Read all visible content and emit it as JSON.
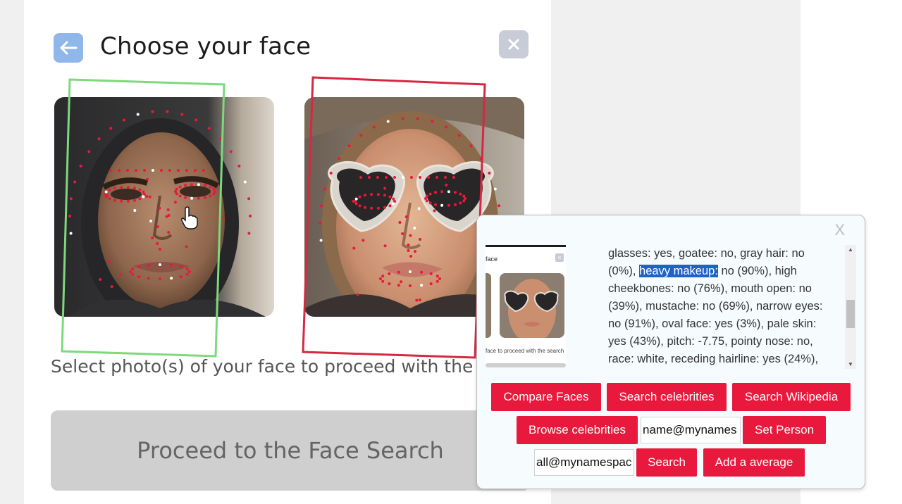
{
  "modal": {
    "title": "Choose your face",
    "instructions": "Select photo(s) of your face to proceed with the s",
    "proceed_label": "Proceed to the Face Search"
  },
  "icons": {
    "back": "arrow-left-icon",
    "close": "close-icon",
    "cursor": "hand-pointer-icon"
  },
  "colors": {
    "back_button": "#8fb7ea",
    "close_button": "#c7ccd6",
    "selected_frame": "#7ed87e",
    "unselected_frame": "#d62840",
    "landmark_red": "#e8193c",
    "action_button": "#e8193c",
    "highlight": "#1e64c8"
  },
  "popup": {
    "close_label": "X",
    "thumbnail": {
      "title": "face",
      "caption": "face to proceed with the search"
    },
    "info": {
      "before": "glasses: yes, goatee: no, gray hair: no (0%), ",
      "highlight": "heavy makeup:",
      "after": " no (90%), high cheekbones: no (76%), mouth open: no (39%), mustache: no (69%), narrow eyes: no (91%), oval face: yes (3%), pale skin: yes (43%), pitch: -7.75, pointy nose: no, race: white, receding hairline: yes (24%),"
    },
    "buttons": {
      "compare_faces": "Compare Faces",
      "search_celebrities": "Search celebrities",
      "search_wikipedia": "Search Wikipedia",
      "browse_celebrities": "Browse celebrities",
      "set_person": "Set Person",
      "search": "Search",
      "add_average": "Add a average"
    },
    "inputs": {
      "person_value": "name@mynames",
      "namespace_value": "all@mynamespac"
    }
  }
}
